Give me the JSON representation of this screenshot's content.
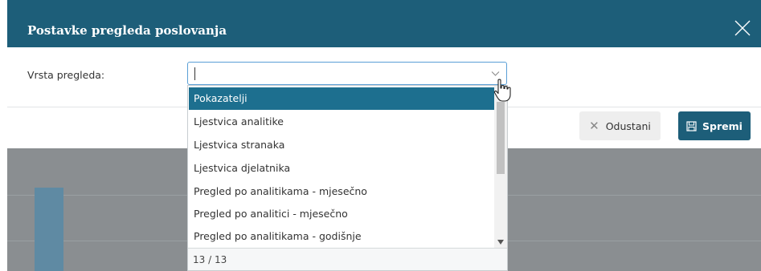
{
  "modal": {
    "title": "Postavke pregleda poslovanja",
    "field_label": "Vrsta pregleda:",
    "input_value": "",
    "cancel_label": "Odustani",
    "save_label": "Spremi",
    "icons": {
      "close": "close-icon",
      "chevron": "chevron-down-icon",
      "save": "save-icon",
      "cancel": "x-icon"
    }
  },
  "dropdown": {
    "options": [
      "Pokazatelji",
      "Ljestvica analitike",
      "Ljestvica stranaka",
      "Ljestvica djelatnika",
      "Pregled po analitikama - mjesečno",
      "Pregled po analitici - mjesečno",
      "Pregled po analitikama - godišnje"
    ],
    "selected_index": 0,
    "count": "13 / 13"
  },
  "colors": {
    "header": "#1d5e79",
    "selected": "#1d6f8f",
    "backdrop": "#8a8e91"
  }
}
